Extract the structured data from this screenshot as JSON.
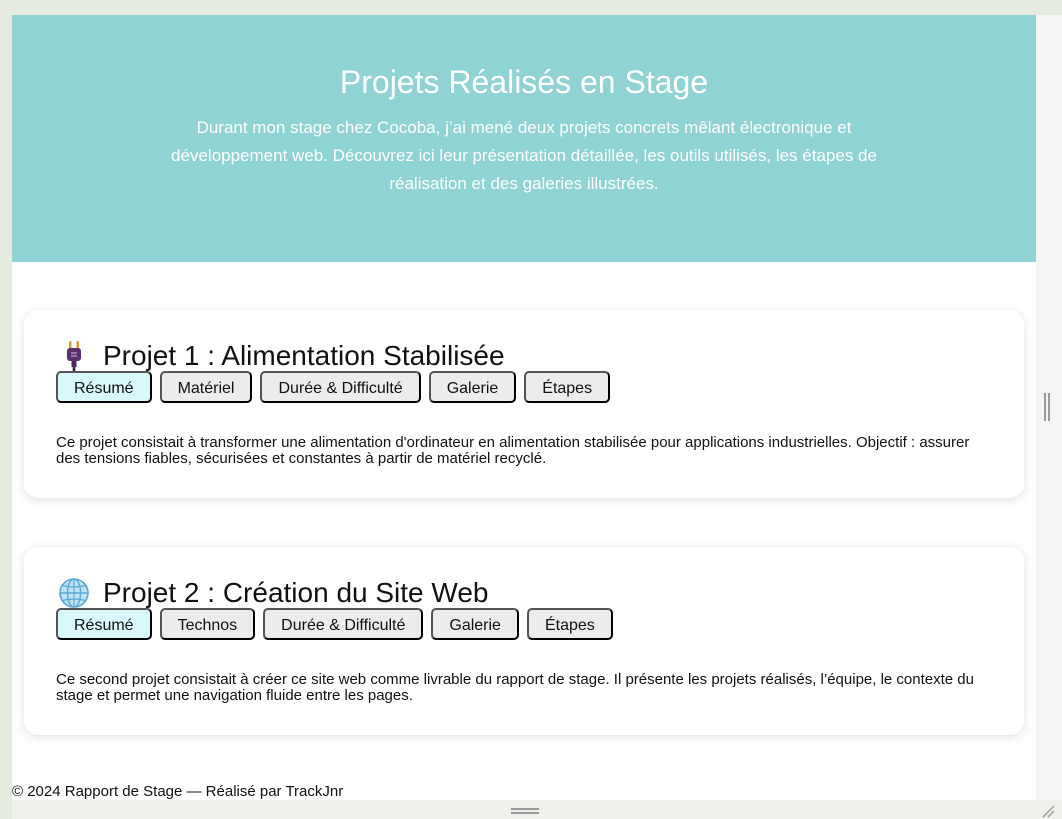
{
  "hero": {
    "title": "Projets Réalisés en Stage",
    "intro": "Durant mon stage chez Cocoba, j’ai mené deux projets concrets mêlant électronique et développement web. Découvrez ici leur présentation détaillée, les outils utilisés, les étapes de réalisation et des galeries illustrées."
  },
  "projects": [
    {
      "icon": "electric-plug-icon",
      "title": "Projet 1 : Alimentation Stabilisée",
      "tabs": [
        "Résumé",
        "Matériel",
        "Durée & Difficulté",
        "Galerie",
        "Étapes"
      ],
      "active_tab": "Résumé",
      "summary": "Ce projet consistait à transformer une alimentation d'ordinateur en alimentation stabilisée pour applications industrielles. Objectif : assurer des tensions fiables, sécurisées et constantes à partir de matériel recyclé."
    },
    {
      "icon": "globe-icon",
      "title": "Projet 2 : Création du Site Web",
      "tabs": [
        "Résumé",
        "Technos",
        "Durée & Difficulté",
        "Galerie",
        "Étapes"
      ],
      "active_tab": "Résumé",
      "summary": "Ce second projet consistait à créer ce site web comme livrable du rapport de stage. Il présente les projets réalisés, l’équipe, le contexte du stage et permet une navigation fluide entre les pages."
    }
  ],
  "footer": {
    "text": "© 2024 Rapport de Stage — Réalisé par TrackJnr"
  },
  "colors": {
    "hero_bg": "#8fd3d4",
    "active_tab": "#d9f8fb",
    "tab": "#ececec",
    "page_bg": "#e6ebe0"
  }
}
